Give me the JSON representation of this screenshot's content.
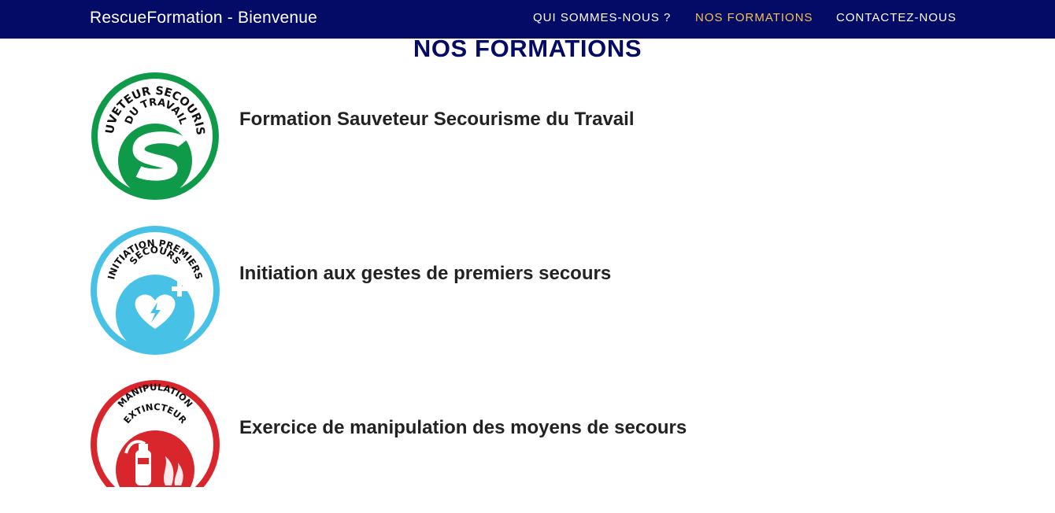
{
  "navbar": {
    "brand": "RescueFormation - Bienvenue",
    "links": [
      {
        "label": "QUI SOMMES-NOUS ?",
        "active": false
      },
      {
        "label": "NOS FORMATIONS",
        "active": true
      },
      {
        "label": "CONTACTEZ-NOUS",
        "active": false
      }
    ]
  },
  "main": {
    "title": "NOS FORMATIONS",
    "formations": [
      {
        "title": "Formation Sauveteur Secourisme du Travail",
        "badge_text_line1": "SAUVETEUR SECOURISTE",
        "badge_text_line2": "DU TRAVAIL",
        "badge_letter": "S",
        "badge_color": "#0f9a4a",
        "badge_icon": "sst-s-icon"
      },
      {
        "title": "Initiation aux gestes de premiers secours",
        "badge_text_line1": "INITIATION PREMIERS",
        "badge_text_line2": "SECOURS",
        "badge_color": "#47c2e6",
        "badge_icon": "heart-defibrillator-icon"
      },
      {
        "title": "Exercice de manipulation des moyens de secours",
        "badge_text_line1": "MANIPULATION",
        "badge_text_line2": "EXTINCTEUR",
        "badge_color": "#d9262c",
        "badge_icon": "fire-extinguisher-icon"
      }
    ]
  },
  "colors": {
    "navbar_bg": "#030b66",
    "nav_active": "#f3c24f",
    "title": "#030b66",
    "text": "#222222"
  }
}
